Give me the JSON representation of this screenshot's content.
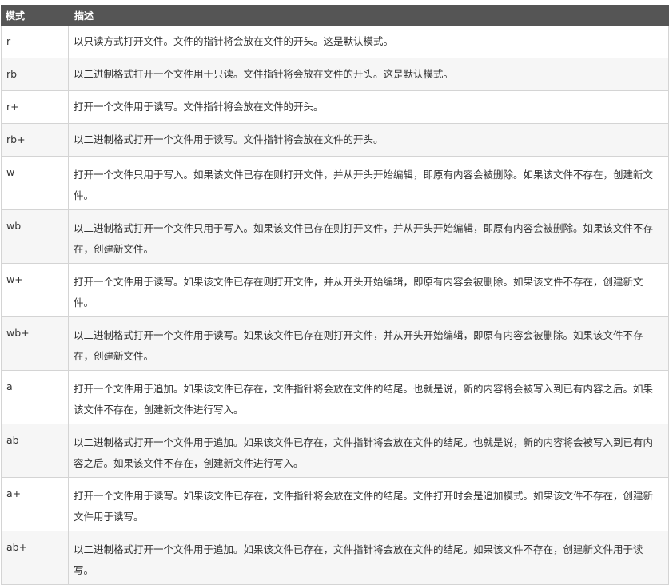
{
  "table": {
    "headers": [
      "模式",
      "描述"
    ],
    "rows": [
      {
        "mode": "r",
        "desc": "以只读方式打开文件。文件的指针将会放在文件的开头。这是默认模式。"
      },
      {
        "mode": "rb",
        "desc": "以二进制格式打开一个文件用于只读。文件指针将会放在文件的开头。这是默认模式。"
      },
      {
        "mode": "r+",
        "desc": "打开一个文件用于读写。文件指针将会放在文件的开头。"
      },
      {
        "mode": "rb+",
        "desc": "以二进制格式打开一个文件用于读写。文件指针将会放在文件的开头。"
      },
      {
        "mode": "w",
        "desc": "打开一个文件只用于写入。如果该文件已存在则打开文件，并从开头开始编辑，即原有内容会被删除。如果该文件不存在，创建新文件。"
      },
      {
        "mode": "wb",
        "desc": "以二进制格式打开一个文件只用于写入。如果该文件已存在则打开文件，并从开头开始编辑，即原有内容会被删除。如果该文件不存在，创建新文件。"
      },
      {
        "mode": "w+",
        "desc": "打开一个文件用于读写。如果该文件已存在则打开文件，并从开头开始编辑，即原有内容会被删除。如果该文件不存在，创建新文件。"
      },
      {
        "mode": "wb+",
        "desc": "以二进制格式打开一个文件用于读写。如果该文件已存在则打开文件，并从开头开始编辑，即原有内容会被删除。如果该文件不存在，创建新文件。"
      },
      {
        "mode": "a",
        "desc": "打开一个文件用于追加。如果该文件已存在，文件指针将会放在文件的结尾。也就是说，新的内容将会被写入到已有内容之后。如果该文件不存在，创建新文件进行写入。"
      },
      {
        "mode": "ab",
        "desc": "以二进制格式打开一个文件用于追加。如果该文件已存在，文件指针将会放在文件的结尾。也就是说，新的内容将会被写入到已有内容之后。如果该文件不存在，创建新文件进行写入。"
      },
      {
        "mode": "a+",
        "desc": "打开一个文件用于读写。如果该文件已存在，文件指针将会放在文件的结尾。文件打开时会是追加模式。如果该文件不存在，创建新文件用于读写。"
      },
      {
        "mode": "ab+",
        "desc": "以二进制格式打开一个文件用于追加。如果该文件已存在，文件指针将会放在文件的结尾。如果该文件不存在，创建新文件用于读写。"
      }
    ]
  }
}
